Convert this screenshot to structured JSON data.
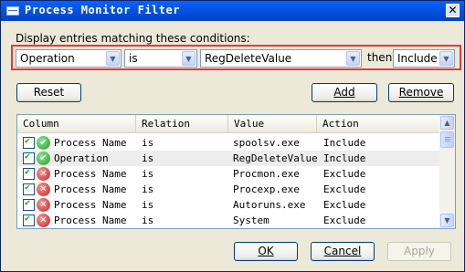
{
  "window": {
    "title": "Process Monitor Filter"
  },
  "conditions": {
    "label": "Display entries matching these conditions:",
    "column": "Operation",
    "relation": "is",
    "value": "RegDeleteValue",
    "then_label": "then",
    "action": "Include"
  },
  "buttons": {
    "reset": "Reset",
    "add": "Add",
    "remove": "Remove",
    "ok": "OK",
    "cancel": "Cancel",
    "apply": "Apply"
  },
  "list": {
    "headers": [
      "Column",
      "Relation",
      "Value",
      "Action"
    ],
    "rows": [
      {
        "checked": true,
        "icon": "include-check-icon",
        "column": "Process Name",
        "relation": "is",
        "value": "spoolsv.exe",
        "action": "Include"
      },
      {
        "checked": true,
        "icon": "include-check-icon",
        "column": "Operation",
        "relation": "is",
        "value": "RegDeleteValue",
        "action": "Include"
      },
      {
        "checked": true,
        "icon": "exclude-x-icon",
        "column": "Process Name",
        "relation": "is",
        "value": "Procmon.exe",
        "action": "Exclude"
      },
      {
        "checked": true,
        "icon": "exclude-x-icon",
        "column": "Process Name",
        "relation": "is",
        "value": "Procexp.exe",
        "action": "Exclude"
      },
      {
        "checked": true,
        "icon": "exclude-x-icon",
        "column": "Process Name",
        "relation": "is",
        "value": "Autoruns.exe",
        "action": "Exclude"
      },
      {
        "checked": true,
        "icon": "exclude-x-icon",
        "column": "Process Name",
        "relation": "is",
        "value": "System",
        "action": "Exclude"
      }
    ]
  },
  "colors": {
    "highlight_border": "#E03B3B",
    "titlebar": "#0054E3",
    "include_icon": "#1E9E1E",
    "exclude_icon": "#C81E1E"
  }
}
